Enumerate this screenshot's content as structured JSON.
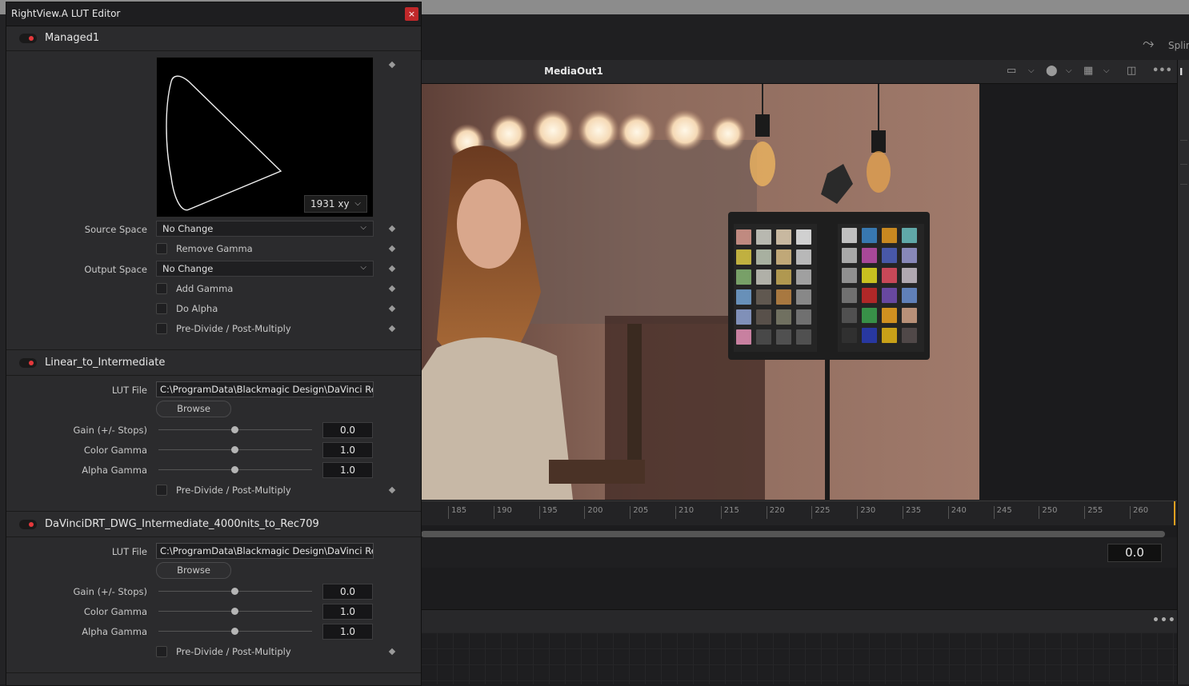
{
  "editor": {
    "title": "RightView.A LUT Editor",
    "close_glyph": "×",
    "managed": {
      "name": "Managed1",
      "gamut_view": "1931 xy",
      "source_space_label": "Source Space",
      "source_space_value": "No Change",
      "remove_gamma_label": "Remove Gamma",
      "output_space_label": "Output Space",
      "output_space_value": "No Change",
      "add_gamma_label": "Add Gamma",
      "do_alpha_label": "Do Alpha",
      "predivide_label": "Pre-Divide / Post-Multiply"
    },
    "lut1": {
      "name": "Linear_to_Intermediate",
      "lut_file_label": "LUT File",
      "lut_file_value": "C:\\ProgramData\\Blackmagic Design\\DaVinci Res",
      "browse_label": "Browse",
      "gain_label": "Gain (+/- Stops)",
      "gain_value": "0.0",
      "color_gamma_label": "Color Gamma",
      "color_gamma_value": "1.0",
      "alpha_gamma_label": "Alpha Gamma",
      "alpha_gamma_value": "1.0",
      "predivide_label": "Pre-Divide / Post-Multiply"
    },
    "lut2": {
      "name": "DaVinciDRT_DWG_Intermediate_4000nits_to_Rec709",
      "lut_file_label": "LUT File",
      "lut_file_value": "C:\\ProgramData\\Blackmagic Design\\DaVinci Res",
      "browse_label": "Browse",
      "gain_label": "Gain (+/- Stops)",
      "gain_value": "0.0",
      "color_gamma_label": "Color Gamma",
      "color_gamma_value": "1.0",
      "alpha_gamma_label": "Alpha Gamma",
      "alpha_gamma_value": "1.0",
      "predivide_label": "Pre-Divide / Post-Multiply"
    }
  },
  "viewer": {
    "title": "MediaOut1",
    "spline_label": "Splin",
    "right_label": "I"
  },
  "timeline": {
    "ticks": [
      "185",
      "190",
      "195",
      "200",
      "205",
      "210",
      "215",
      "220",
      "225",
      "230",
      "235",
      "240",
      "245",
      "250",
      "255",
      "260"
    ],
    "current_time": "0.0"
  },
  "colors": {
    "accent_red": "#e5383b",
    "playhead": "#e0a020"
  }
}
